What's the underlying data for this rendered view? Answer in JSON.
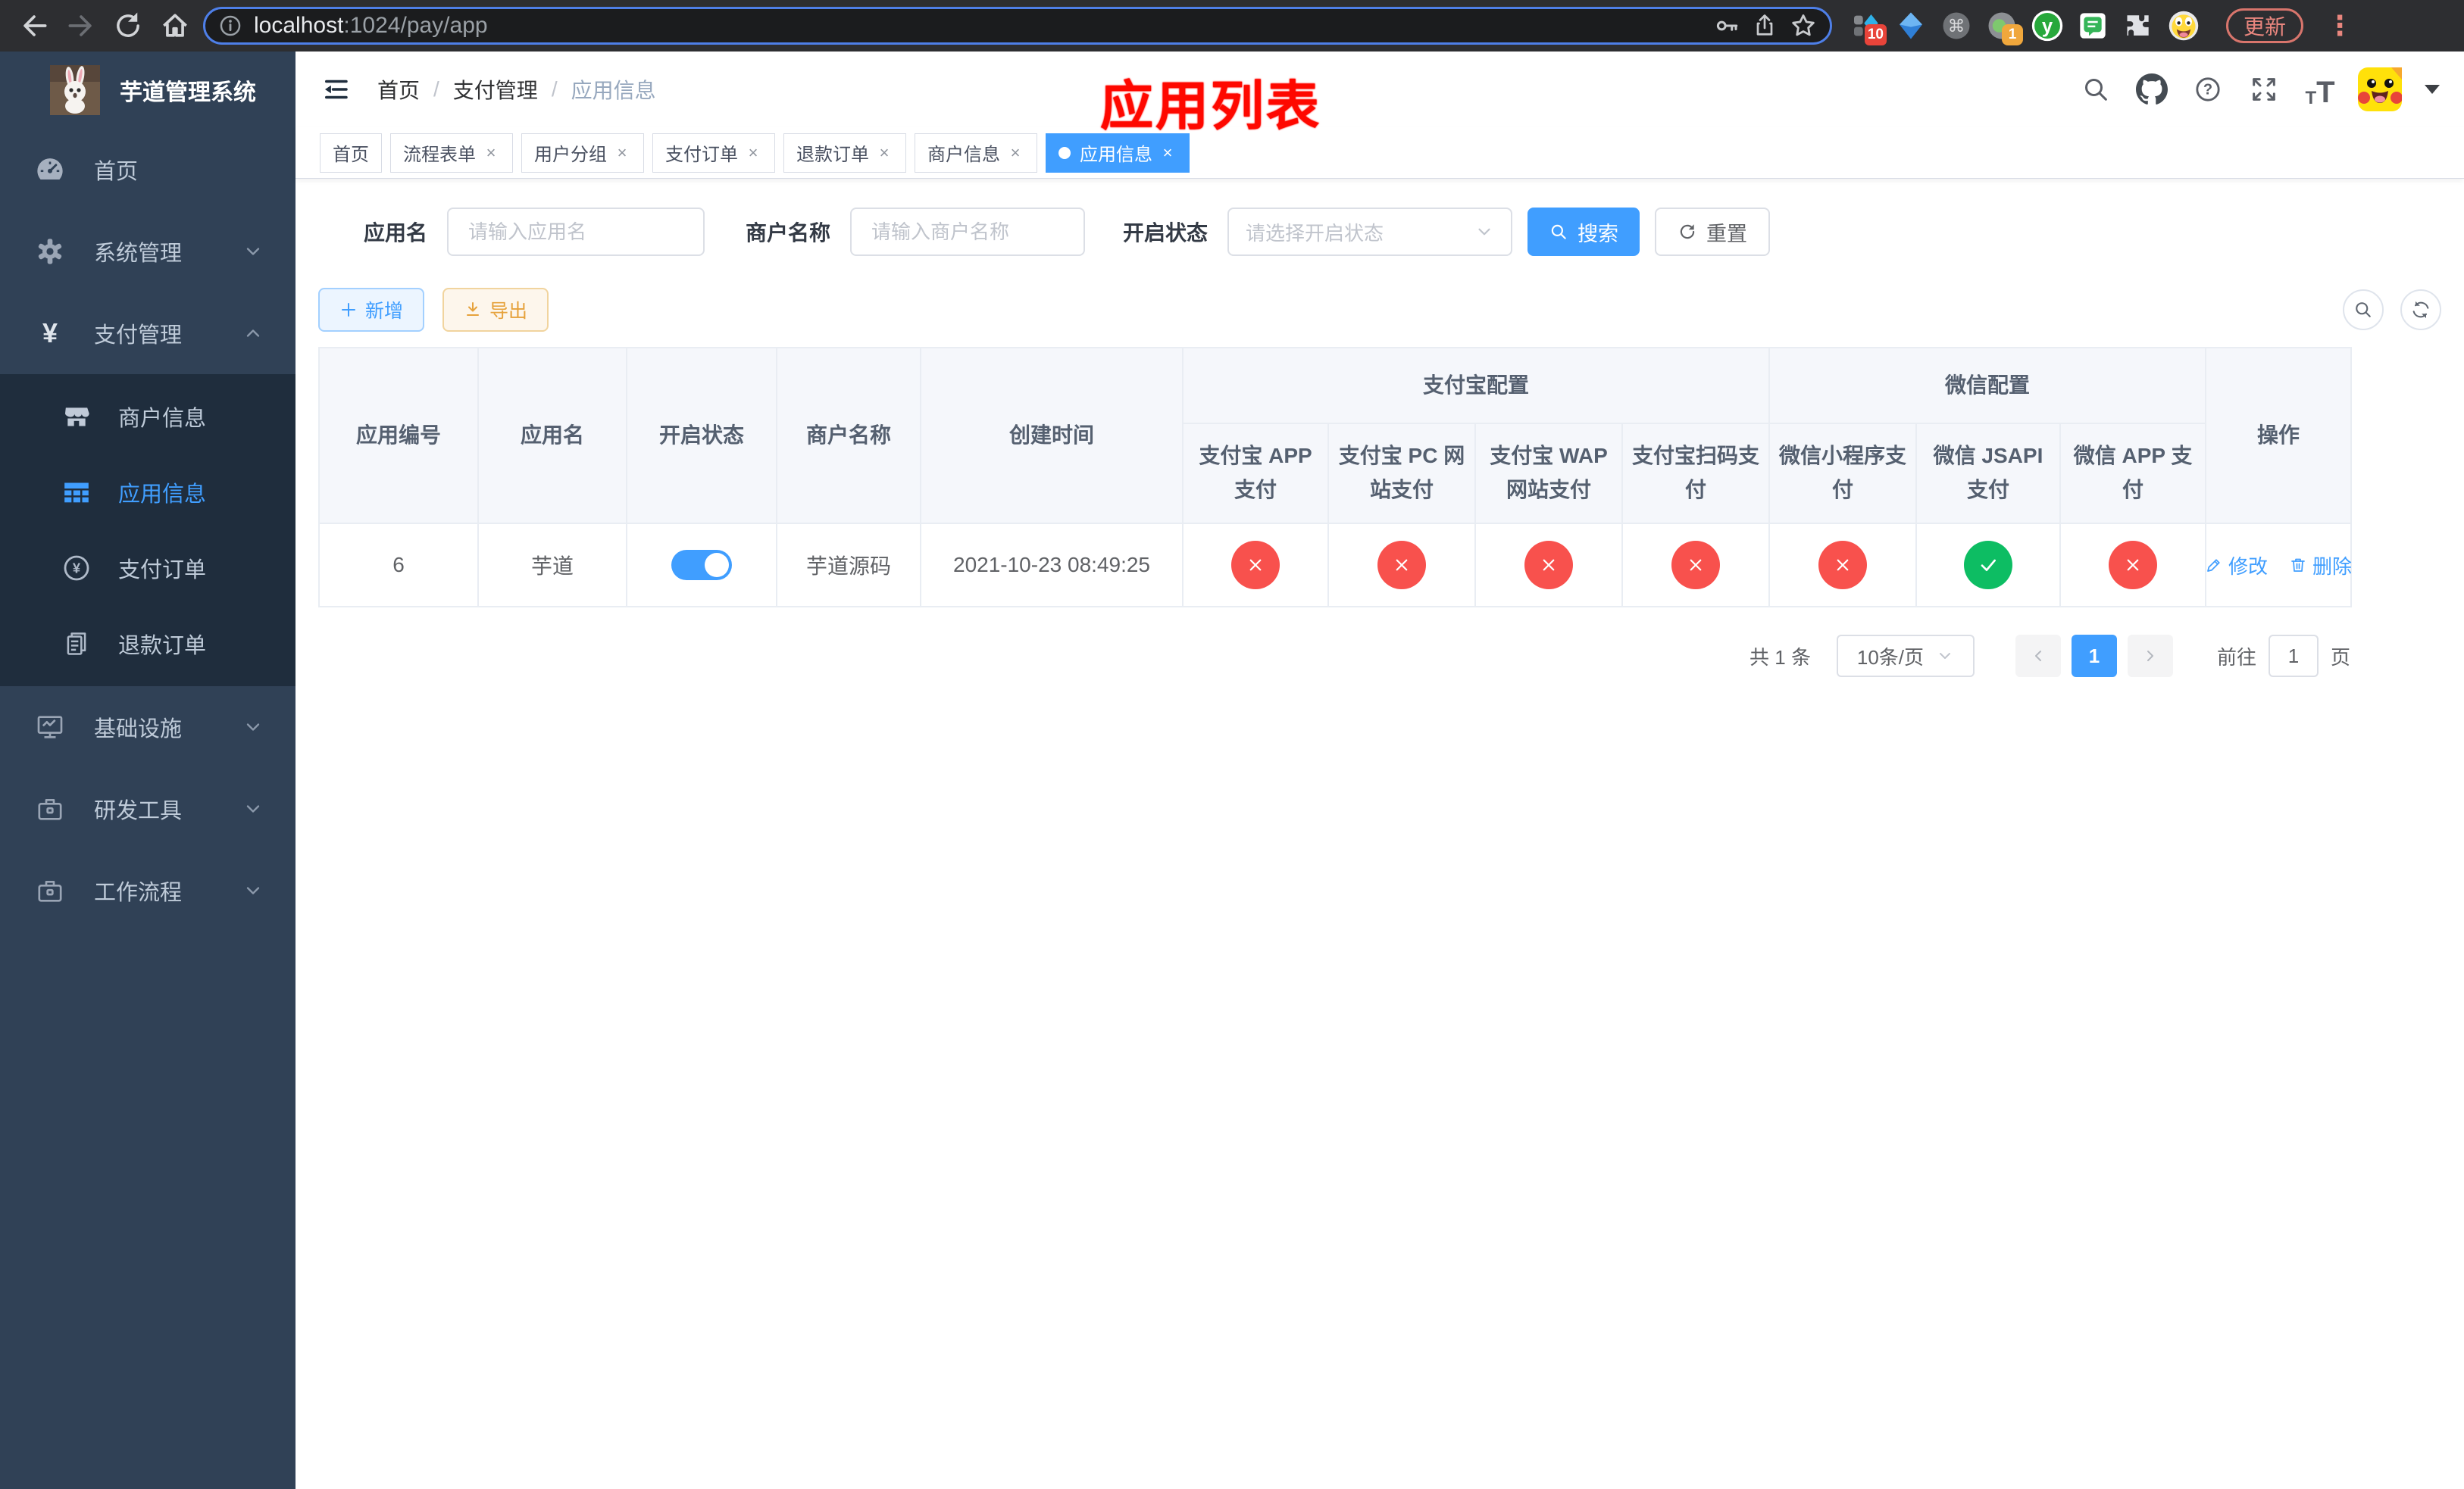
{
  "browser": {
    "url_host": "localhost",
    "url_rest": ":1024/pay/app",
    "update_label": "更新",
    "ext_badge_10": "10",
    "ext_badge_1": "1",
    "ext_letter_y": "y"
  },
  "icons": {
    "close": "×",
    "breadcrumb_separator": "/",
    "command": "⌘",
    "dots": "⋮",
    "yen": "¥",
    "question": "?"
  },
  "sidebar": {
    "title": "芋道管理系统",
    "menu": [
      {
        "label": "首页"
      },
      {
        "label": "系统管理"
      },
      {
        "label": "支付管理"
      },
      {
        "label": "基础设施"
      },
      {
        "label": "研发工具"
      },
      {
        "label": "工作流程"
      }
    ],
    "submenu": [
      {
        "label": "商户信息"
      },
      {
        "label": "应用信息",
        "active": true
      },
      {
        "label": "支付订单"
      },
      {
        "label": "退款订单"
      }
    ]
  },
  "navbar": {
    "breadcrumb": [
      "首页",
      "支付管理",
      "应用信息"
    ],
    "annotation": "应用列表"
  },
  "tabs": [
    {
      "label": "首页",
      "closable": false,
      "active": false
    },
    {
      "label": "流程表单",
      "closable": true,
      "active": false
    },
    {
      "label": "用户分组",
      "closable": true,
      "active": false
    },
    {
      "label": "支付订单",
      "closable": true,
      "active": false
    },
    {
      "label": "退款订单",
      "closable": true,
      "active": false
    },
    {
      "label": "商户信息",
      "closable": true,
      "active": false
    },
    {
      "label": "应用信息",
      "closable": true,
      "active": true
    }
  ],
  "search": {
    "app_name_label": "应用名",
    "app_name_placeholder": "请输入应用名",
    "merchant_label": "商户名称",
    "merchant_placeholder": "请输入商户名称",
    "status_label": "开启状态",
    "status_placeholder": "请选择开启状态",
    "search_label": "搜索",
    "reset_label": "重置"
  },
  "toolbar": {
    "add_label": "新增",
    "export_label": "导出"
  },
  "table": {
    "groups": [
      {
        "label": "支付宝配置",
        "span": 4
      },
      {
        "label": "微信配置",
        "span": 3
      }
    ],
    "columns": [
      "应用编号",
      "应用名",
      "开启状态",
      "商户名称",
      "创建时间",
      "支付宝 APP 支付",
      "支付宝 PC 网站支付",
      "支付宝 WAP 网站支付",
      "支付宝扫码支付",
      "微信小程序支付",
      "微信 JSAPI 支付",
      "微信 APP 支付",
      "操作"
    ],
    "rows": [
      {
        "id": "6",
        "name": "芋道",
        "enabled": true,
        "merchant": "芋道源码",
        "created": "2021-10-23 08:49:25",
        "statuses": [
          "error",
          "error",
          "error",
          "error",
          "error",
          "success",
          "error"
        ],
        "edit_label": "修改",
        "delete_label": "删除"
      }
    ]
  },
  "pagination": {
    "total": "共 1 条",
    "page_size": "10条/页",
    "current_page": "1",
    "goto_label": "前往",
    "goto_value": "1",
    "page_unit": "页"
  },
  "colors": {
    "accent_blue": "#409eff",
    "danger_red": "#f8514d",
    "success_green": "#0dbd63",
    "warning_orange": "#e6a23c",
    "annotation_red": "#fe0800",
    "sidebar_bg": "#304156",
    "submenu_bg": "#1f2d3d"
  }
}
